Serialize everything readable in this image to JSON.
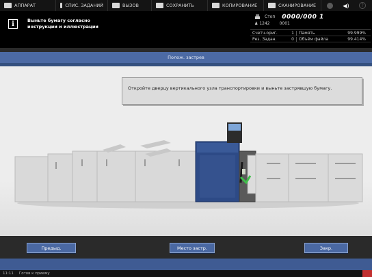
{
  "tabs": [
    {
      "label": "АППАРАТ",
      "icon": "machine-icon"
    },
    {
      "label": "СПИС. ЗАДАНИЙ",
      "icon": "job-list-icon"
    },
    {
      "label": "ВЫЗОВ",
      "icon": "recall-icon"
    },
    {
      "label": "СОХРАНИТЬ",
      "icon": "save-icon"
    },
    {
      "label": "КОПИРОВАНИЕ",
      "icon": "copy-icon"
    },
    {
      "label": "СКАНИРОВАНИЕ",
      "icon": "scan-icon"
    }
  ],
  "top_extra": {
    "help": "?"
  },
  "message": {
    "line1": "Выньте бумагу согласно",
    "line2": "инструкции и иллюстрации"
  },
  "status": {
    "state": "Стоп",
    "counter": "0000/000 1",
    "sub_left": "1242",
    "sub_right": "0001",
    "orig_label": "Счетч.ориг.",
    "orig_value": "1",
    "memory_label": "Память",
    "memory_value": "99.999%",
    "reserve_label": "Рез. Задан.",
    "reserve_value": "0",
    "filevol_label": "Объём файла",
    "filevol_value": "99.414%"
  },
  "title": "Полож. застрев",
  "instruction": "Откройте дверцу вертикального узла транспортировки и выньте застрявшую бумагу.",
  "buttons": {
    "prev": "Предыд.",
    "location": "Место застр.",
    "close": "Закр."
  },
  "footer": {
    "time": "11:11",
    "text": "Готов к приему"
  }
}
